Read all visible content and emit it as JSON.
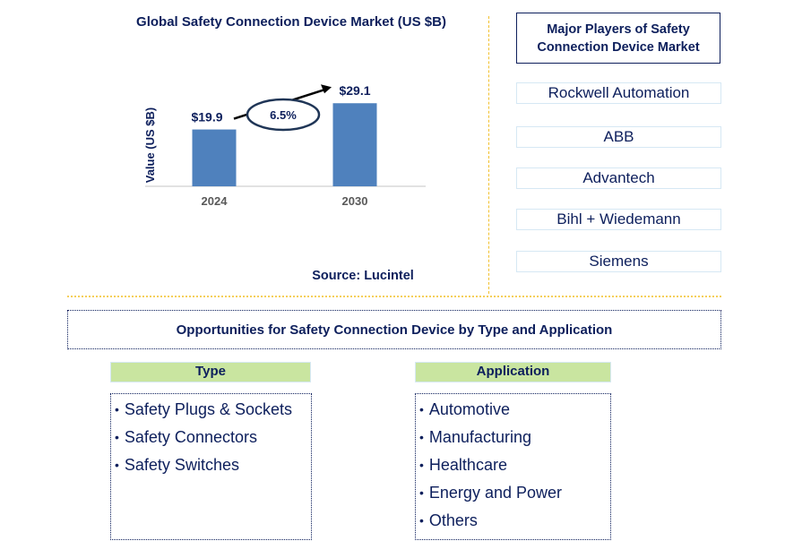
{
  "chart_data": {
    "type": "bar",
    "title": "Global Safety Connection Device Market (US $B)",
    "xlabel": "",
    "ylabel": "Value (US $B)",
    "categories": [
      "2024",
      "2030"
    ],
    "values": [
      19.9,
      29.1
    ],
    "data_labels": [
      "$19.9",
      "$29.1"
    ],
    "ylim": [
      0,
      32
    ],
    "grid": false,
    "bar_color": "#4f81bd",
    "annotation": {
      "type": "cagr-arrow",
      "label": "6.5%",
      "from": "2024",
      "to": "2030"
    }
  },
  "source": "Source: Lucintel",
  "players": {
    "title": "Major Players of Safety Connection Device Market",
    "items": [
      "Rockwell Automation",
      "ABB",
      "Advantech",
      "Bihl + Wiedemann",
      "Siemens"
    ]
  },
  "opportunities": {
    "title": "Opportunities for Safety Connection Device by Type and Application",
    "type": {
      "heading": "Type",
      "items": [
        "Safety Plugs & Sockets",
        "Safety Connectors",
        "Safety Switches"
      ]
    },
    "application": {
      "heading": "Application",
      "items": [
        "Automotive",
        "Manufacturing",
        "Healthcare",
        "Energy and Power",
        "Others"
      ]
    }
  },
  "colors": {
    "text": "#0d1f5c",
    "bar": "#4f81bd",
    "segment_header": "#c9e5a0",
    "divider": "#f2c12e"
  }
}
